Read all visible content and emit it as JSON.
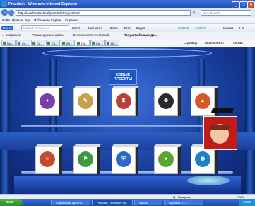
{
  "window": {
    "title": "Prazdnik - Windows Internet Explorer",
    "min": "_",
    "max": "□",
    "close": "✕"
  },
  "address": {
    "url": "http://localhost/school/prazdnik/Project.html",
    "search_placeholder": "Live Search"
  },
  "menu": [
    "Файл",
    "Правка",
    "Вид",
    "Избранное",
    "Сервис",
    "Справка"
  ],
  "toolbar1": {
    "mail": "Mail.ru",
    "search_value": "Поиск в Интернете",
    "find_btn": "Найти!",
    "items": [
      "Mail.ru",
      "Агент",
      "Mail агент",
      "Блоги",
      "Фото",
      "Видео"
    ],
    "stock1": "29.5605",
    "stock2": "42.5497",
    "city": "Москва",
    "temp": "0 °С"
  },
  "toolbar2": {
    "favorites": "Избранное",
    "sites1": "Рекомендуемые сайты",
    "sites2": "Бесплатная почта Hotmail",
    "sites3": "Получить больше до..."
  },
  "tabs": [
    "Гла...",
    "Сп...",
    "Сп...",
    "Сп...",
    "Ин...",
    "Пр...",
    "Сп...",
    "Ин..."
  ],
  "tab_tools": {
    "page": "Страница",
    "safety": "Безопасность",
    "service": "Сервис"
  },
  "banner": {
    "line1": "НОВЫЕ",
    "line2": "ПРОЕКТЫ"
  },
  "status": {
    "zone": "Интернет",
    "zoom": "100%"
  },
  "taskbar": {
    "start": "пуск",
    "buttons": [
      "Справочник Цел-Ро...",
      "Prazdnik - Windows Int...",
      "Файлы",
      "Проекты: 1 - 2 ..."
    ],
    "clock": "13:55"
  }
}
